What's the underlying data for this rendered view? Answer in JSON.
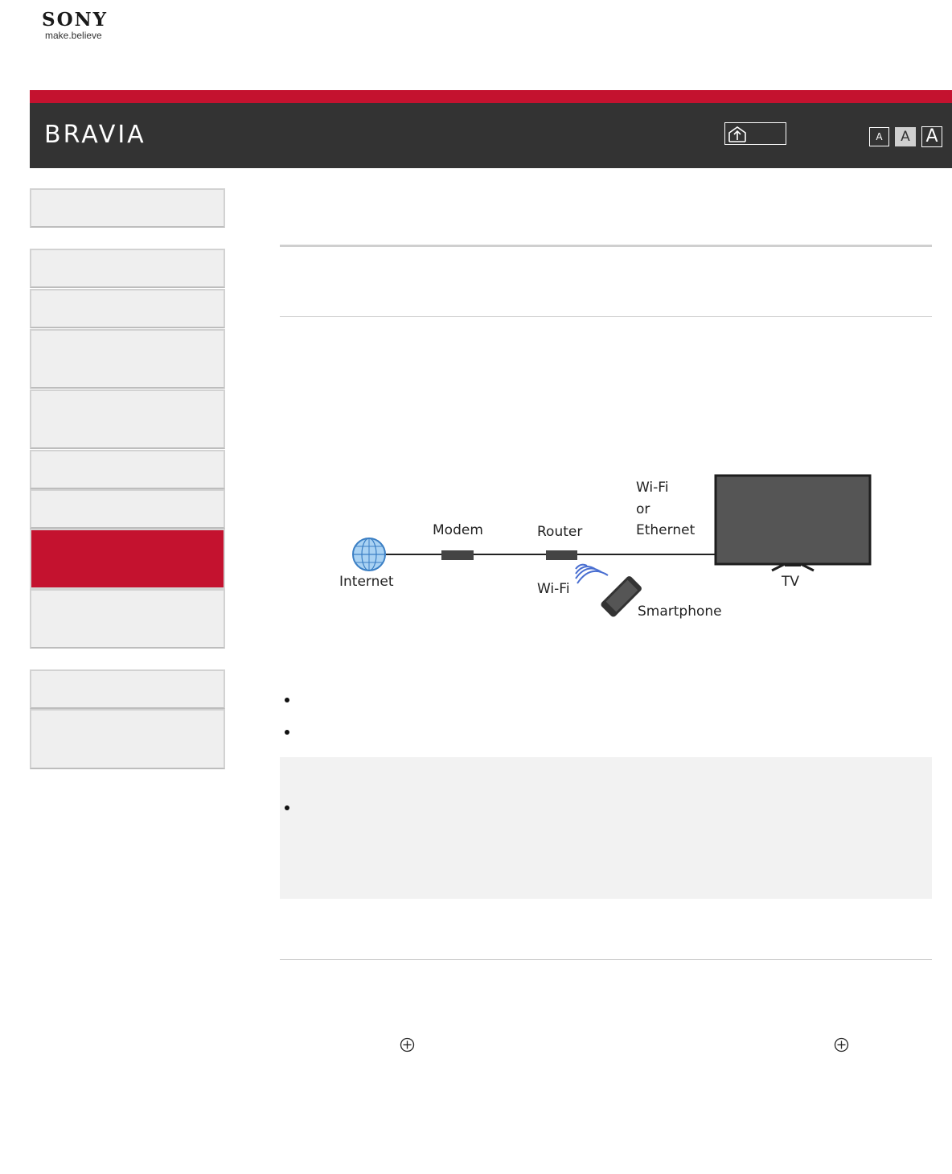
{
  "brand": {
    "logo_word": "SONY",
    "logo_tagline": "make.believe",
    "product": "BRAVIA"
  },
  "header": {
    "top_button_icon": "home-upload-icon",
    "font_sizes": [
      "A",
      "A",
      "A"
    ],
    "colors": {
      "stripe": "#c4122f",
      "bar": "#333333",
      "active_nav": "#c4122f"
    }
  },
  "sidebar": {
    "groups": [
      {
        "items": [
          {
            "label": ""
          }
        ]
      },
      {
        "items": [
          {
            "label": ""
          },
          {
            "label": ""
          },
          {
            "label": ""
          },
          {
            "label": ""
          },
          {
            "label": ""
          },
          {
            "label": ""
          },
          {
            "label": "",
            "active": true
          },
          {
            "label": ""
          }
        ]
      },
      {
        "items": [
          {
            "label": ""
          },
          {
            "label": ""
          }
        ]
      }
    ]
  },
  "diagram": {
    "labels": {
      "internet": "Internet",
      "modem": "Modem",
      "router": "Router",
      "wifi_or_ethernet": [
        "Wi-Fi",
        "or",
        "Ethernet"
      ],
      "wifi": "Wi-Fi",
      "smartphone": "Smartphone",
      "tv": "TV"
    },
    "icons": [
      "globe-icon",
      "modem-icon",
      "router-icon",
      "wifi-waves-icon",
      "smartphone-icon",
      "tv-icon"
    ]
  },
  "content": {
    "bullets_count": 2,
    "note_bullets_count": 1,
    "inline_icons": [
      "circle-plus-icon",
      "circle-plus-icon"
    ]
  }
}
